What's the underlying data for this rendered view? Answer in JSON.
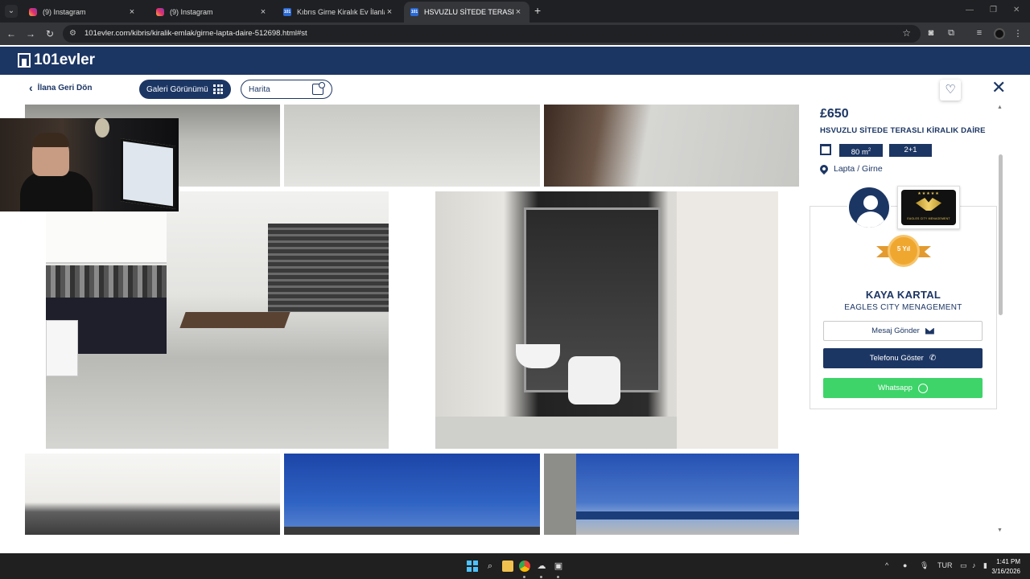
{
  "browser": {
    "tabs": [
      {
        "label": "(9) Instagram",
        "favicon": "instagram-icon"
      },
      {
        "label": "(9) Instagram",
        "favicon": "instagram-icon"
      },
      {
        "label": "Kıbrıs Girne Kiralık Ev İlanları ve",
        "favicon": "101evler-icon"
      },
      {
        "label": "HSVUZLU SİTEDE TERASLI KİRA",
        "favicon": "101evler-icon",
        "active": true
      }
    ],
    "url": "101evler.com/kibris/kiralik-emlak/girne-lapta-daire-512698.html#st",
    "favicon_text": "101"
  },
  "site": {
    "logo_text": "101evler",
    "brand_color": "#1c3664"
  },
  "subbar": {
    "back_label": "İlana Geri Dön",
    "gallery_label": "Galeri Görünümü",
    "map_label": "Harita"
  },
  "listing": {
    "price": "£650",
    "title": "HSVUZLU SİTEDE TERASLI KİRALIK DAİRE",
    "area": "80 m",
    "area_sup": "2",
    "rooms": "2+1",
    "location": "Lapta / Girne"
  },
  "agent": {
    "name": "KAYA KARTAL",
    "company": "EAGLES CITY MENAGEMENT",
    "agency_logo_text": "EAGLES CITY MENAGEMENT",
    "badge_text": "5 Yıl",
    "message_button": "Mesaj Gönder",
    "phone_button": "Telefonu Göster",
    "whatsapp_button": "Whatsapp",
    "whatsapp_color": "#3ed46a"
  },
  "gallery": {
    "photos": [
      "living-room-photo",
      "kitchen-dining-photo",
      "bedroom-tv-photo",
      "kitchen-living-photo",
      "bathroom-photo",
      "kitchen-cabinets-photo",
      "sky-roof-photo",
      "sea-view-photo"
    ]
  },
  "taskbar": {
    "language": "TUR",
    "time": "1:41 PM",
    "date": "3/16/2026"
  }
}
